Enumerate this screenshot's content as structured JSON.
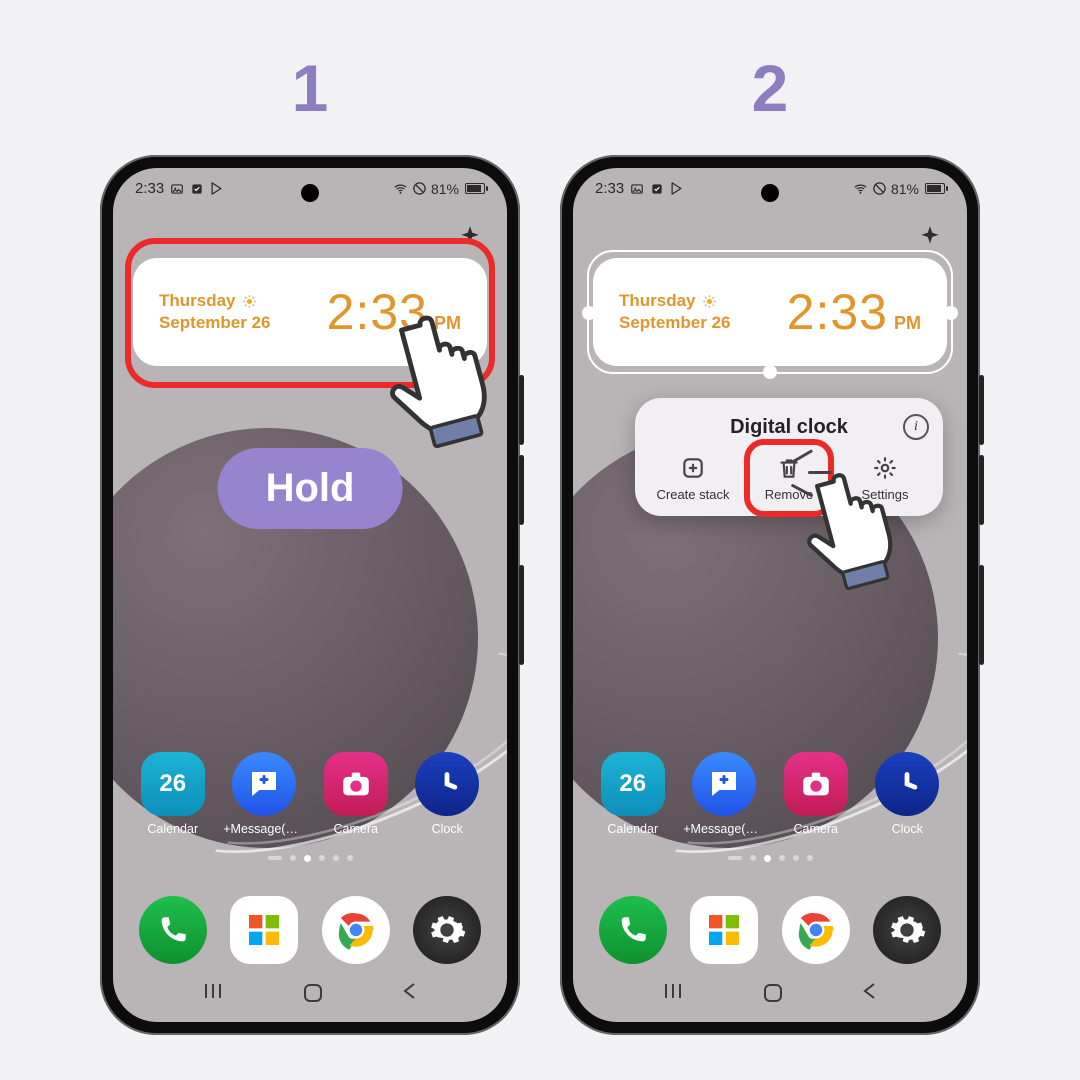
{
  "steps": {
    "one": "1",
    "two": "2"
  },
  "status": {
    "time": "2:33",
    "battery_pct": "81%"
  },
  "widget": {
    "day": "Thursday",
    "date": "September 26",
    "time": "2:33",
    "ampm": "PM"
  },
  "hold_label": "Hold",
  "popup": {
    "title": "Digital clock",
    "actions": {
      "create_stack": "Create stack",
      "remove": "Remove",
      "settings": "Settings"
    }
  },
  "apps": {
    "calendar": {
      "label": "Calendar",
      "day_num": "26"
    },
    "message": "+Message(SM...",
    "camera": "Camera",
    "clock": "Clock"
  },
  "dock": {
    "phone": "Phone",
    "microsoft": "Microsoft",
    "chrome": "Chrome",
    "settings": "Settings"
  },
  "nav": {
    "recents": "|||",
    "home": "◯",
    "back": "<"
  }
}
